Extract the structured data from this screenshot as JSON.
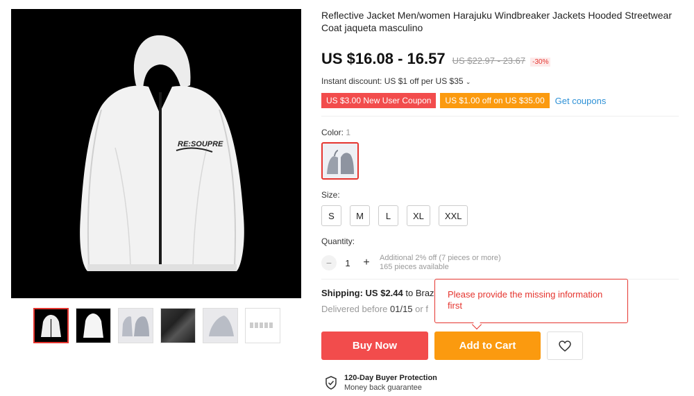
{
  "product": {
    "title": "Reflective Jacket Men/women Harajuku Windbreaker Jackets Hooded Streetwear Coat jaqueta masculino",
    "jacket_print": "RE:SOUPRE"
  },
  "price": {
    "current": "US $16.08 - 16.57",
    "original": "US $22.97 - 23.67",
    "discount": "-30%"
  },
  "instant_discount": "Instant discount: US $1 off per US $35",
  "coupons": [
    {
      "label": "US $3.00 New User Coupon"
    },
    {
      "label": "US $1.00 off on US $35.00"
    }
  ],
  "get_coupons": "Get coupons",
  "color": {
    "label": "Color:",
    "value": "1"
  },
  "size": {
    "label": "Size:",
    "options": [
      "S",
      "M",
      "L",
      "XL",
      "XXL"
    ]
  },
  "quantity": {
    "label": "Quantity:",
    "value": "1",
    "minus": "−",
    "plus": "+",
    "note1": "Additional 2% off (7 pieces or more)",
    "note2": "165 pieces available"
  },
  "shipping": {
    "label": "Shipping: US $2.44",
    "to": " to Braz",
    "delivered_prefix": "Delivered before ",
    "delivered_date": "01/15",
    "delivered_suffix": " or f"
  },
  "tooltip": "Please provide the missing information first",
  "buttons": {
    "buy_now": "Buy Now",
    "add_to_cart": "Add to Cart"
  },
  "protection": {
    "title": "120-Day Buyer Protection",
    "subtitle": "Money back guarantee"
  },
  "colors": {
    "accent_red": "#f24c4c",
    "accent_orange": "#fb9a0f",
    "link_blue": "#2e91d6"
  },
  "icons": [
    "heart-icon",
    "shield-check-icon",
    "chevron-down-icon"
  ]
}
